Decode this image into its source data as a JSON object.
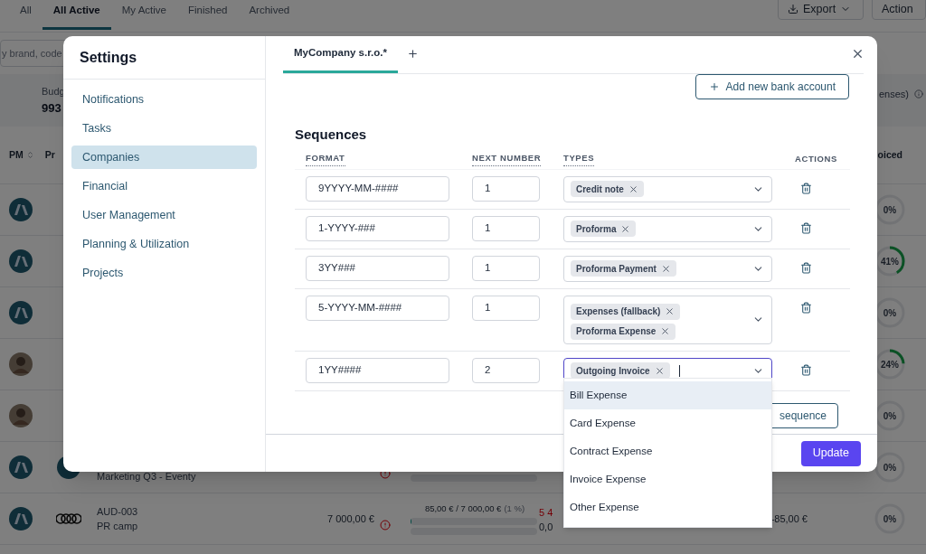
{
  "background": {
    "tabs": [
      {
        "label": "All",
        "selected": false
      },
      {
        "label": "All Active",
        "selected": true
      },
      {
        "label": "My Active",
        "selected": false
      },
      {
        "label": "Finished",
        "selected": false
      },
      {
        "label": "Archived",
        "selected": false
      }
    ],
    "buttons": [
      {
        "label": "Export",
        "kind": "dropdown"
      },
      {
        "label": "Action",
        "kind": "plain"
      }
    ],
    "search": {
      "placeholder": "y brand, code"
    },
    "summary": {
      "label": "Budg",
      "value": "993",
      "note": "enses)"
    },
    "columns": [
      "PM",
      "Pr",
      "oiced"
    ],
    "rows": [
      {
        "avatar": {
          "kind": "logo"
        },
        "ring": {
          "text": "0%"
        }
      },
      {
        "avatar": {
          "kind": "logo"
        },
        "ring": {
          "level": 0.41,
          "text": "41%"
        }
      },
      {
        "avatar": {
          "kind": "logo"
        },
        "ring": {
          "text": "0%"
        }
      },
      {
        "avatar": {
          "kind": "photo"
        },
        "ring": {
          "level": 0.24,
          "text": "24%"
        }
      },
      {
        "avatar": {
          "kind": "photo"
        },
        "ring": {
          "text": "0%"
        }
      },
      {
        "avatar": {
          "kind": "logo"
        },
        "project_logo": {
          "kind": "circle"
        },
        "name": "Marketing Q3 - Eventy",
        "alert": true,
        "bars": [
          {
            "kind": "track"
          }
        ],
        "ring": {
          "text": "0%"
        }
      },
      {
        "avatar": {
          "kind": "logo"
        },
        "project_logo": {
          "kind": "rings"
        },
        "code": "AUD-003",
        "name": "PR camp",
        "budget": "7 000,00 €",
        "alert": true,
        "spent": "85,00 € / 7 000,00 €",
        "share": "(1 %)",
        "bars": [
          {
            "kind": "progress",
            "level": 0.01
          },
          {
            "kind": "track"
          }
        ],
        "red_value": "5 4",
        "amount": "0,0",
        "balance": "-85,00 €",
        "ring": {
          "text": "0%"
        }
      }
    ]
  },
  "settings": {
    "title": "Settings",
    "nav": [
      {
        "label": "Notifications",
        "selected": false
      },
      {
        "label": "Tasks",
        "selected": false
      },
      {
        "label": "Companies",
        "selected": true
      },
      {
        "label": "Financial",
        "selected": false
      },
      {
        "label": "User Management",
        "selected": false
      },
      {
        "label": "Planning & Utilization",
        "selected": false
      },
      {
        "label": "Projects",
        "selected": false
      }
    ],
    "company_tabs": [
      {
        "label": "MyCompany s.r.o.*",
        "selected": true
      }
    ],
    "add_bank_account": "Add new bank account",
    "section_title": "Sequences",
    "columns": [
      "FORMAT",
      "NEXT NUMBER",
      "TYPES",
      "ACTIONS"
    ],
    "sequences": [
      {
        "format": "9YYYY-MM-####",
        "next_number": "1",
        "types": [
          "Credit note"
        ],
        "focused": false
      },
      {
        "format": "1-YYYY-###",
        "next_number": "1",
        "types": [
          "Proforma"
        ],
        "focused": false
      },
      {
        "format": "3YY###",
        "next_number": "1",
        "types": [
          "Proforma Payment"
        ],
        "focused": false
      },
      {
        "format": "5-YYYY-MM-####",
        "next_number": "1",
        "types": [
          "Expenses (fallback)",
          "Proforma Expense"
        ],
        "focused": false
      },
      {
        "format": "1YY####",
        "next_number": "2",
        "types": [
          "Outgoing Invoice"
        ],
        "focused": true
      }
    ],
    "add_sequence": "sequence",
    "dropdown": {
      "options": [
        {
          "label": "Bill Expense",
          "selected": true
        },
        {
          "label": "Card Expense",
          "selected": false
        },
        {
          "label": "Contract Expense",
          "selected": false
        },
        {
          "label": "Invoice Expense",
          "selected": false
        },
        {
          "label": "Other Expense",
          "selected": false
        }
      ]
    },
    "submit": "Update"
  }
}
